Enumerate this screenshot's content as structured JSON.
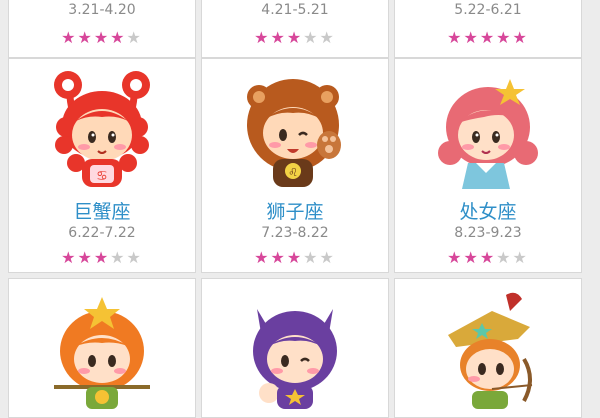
{
  "colors": {
    "star_filled": "#d7479a",
    "star_empty": "#c9c9c9",
    "name": "#2f8fc8",
    "date": "#8a8a8a"
  },
  "signs": [
    {
      "name": "",
      "dates": "3.21-4.20",
      "rating": 4,
      "icon": "aries-character-icon"
    },
    {
      "name": "",
      "dates": "4.21-5.21",
      "rating": 3,
      "icon": "taurus-character-icon"
    },
    {
      "name": "",
      "dates": "5.22-6.21",
      "rating": 5,
      "icon": "gemini-character-icon"
    },
    {
      "name": "巨蟹座",
      "dates": "6.22-7.22",
      "rating": 3,
      "icon": "cancer-crab-character-icon"
    },
    {
      "name": "狮子座",
      "dates": "7.23-8.22",
      "rating": 3,
      "icon": "leo-lion-character-icon"
    },
    {
      "name": "处女座",
      "dates": "8.23-9.23",
      "rating": 3,
      "icon": "virgo-maiden-character-icon"
    },
    {
      "name": "",
      "dates": "",
      "rating": 0,
      "icon": "libra-scales-character-icon"
    },
    {
      "name": "",
      "dates": "",
      "rating": 0,
      "icon": "scorpio-character-icon"
    },
    {
      "name": "",
      "dates": "",
      "rating": 0,
      "icon": "sagittarius-archer-character-icon"
    }
  ]
}
